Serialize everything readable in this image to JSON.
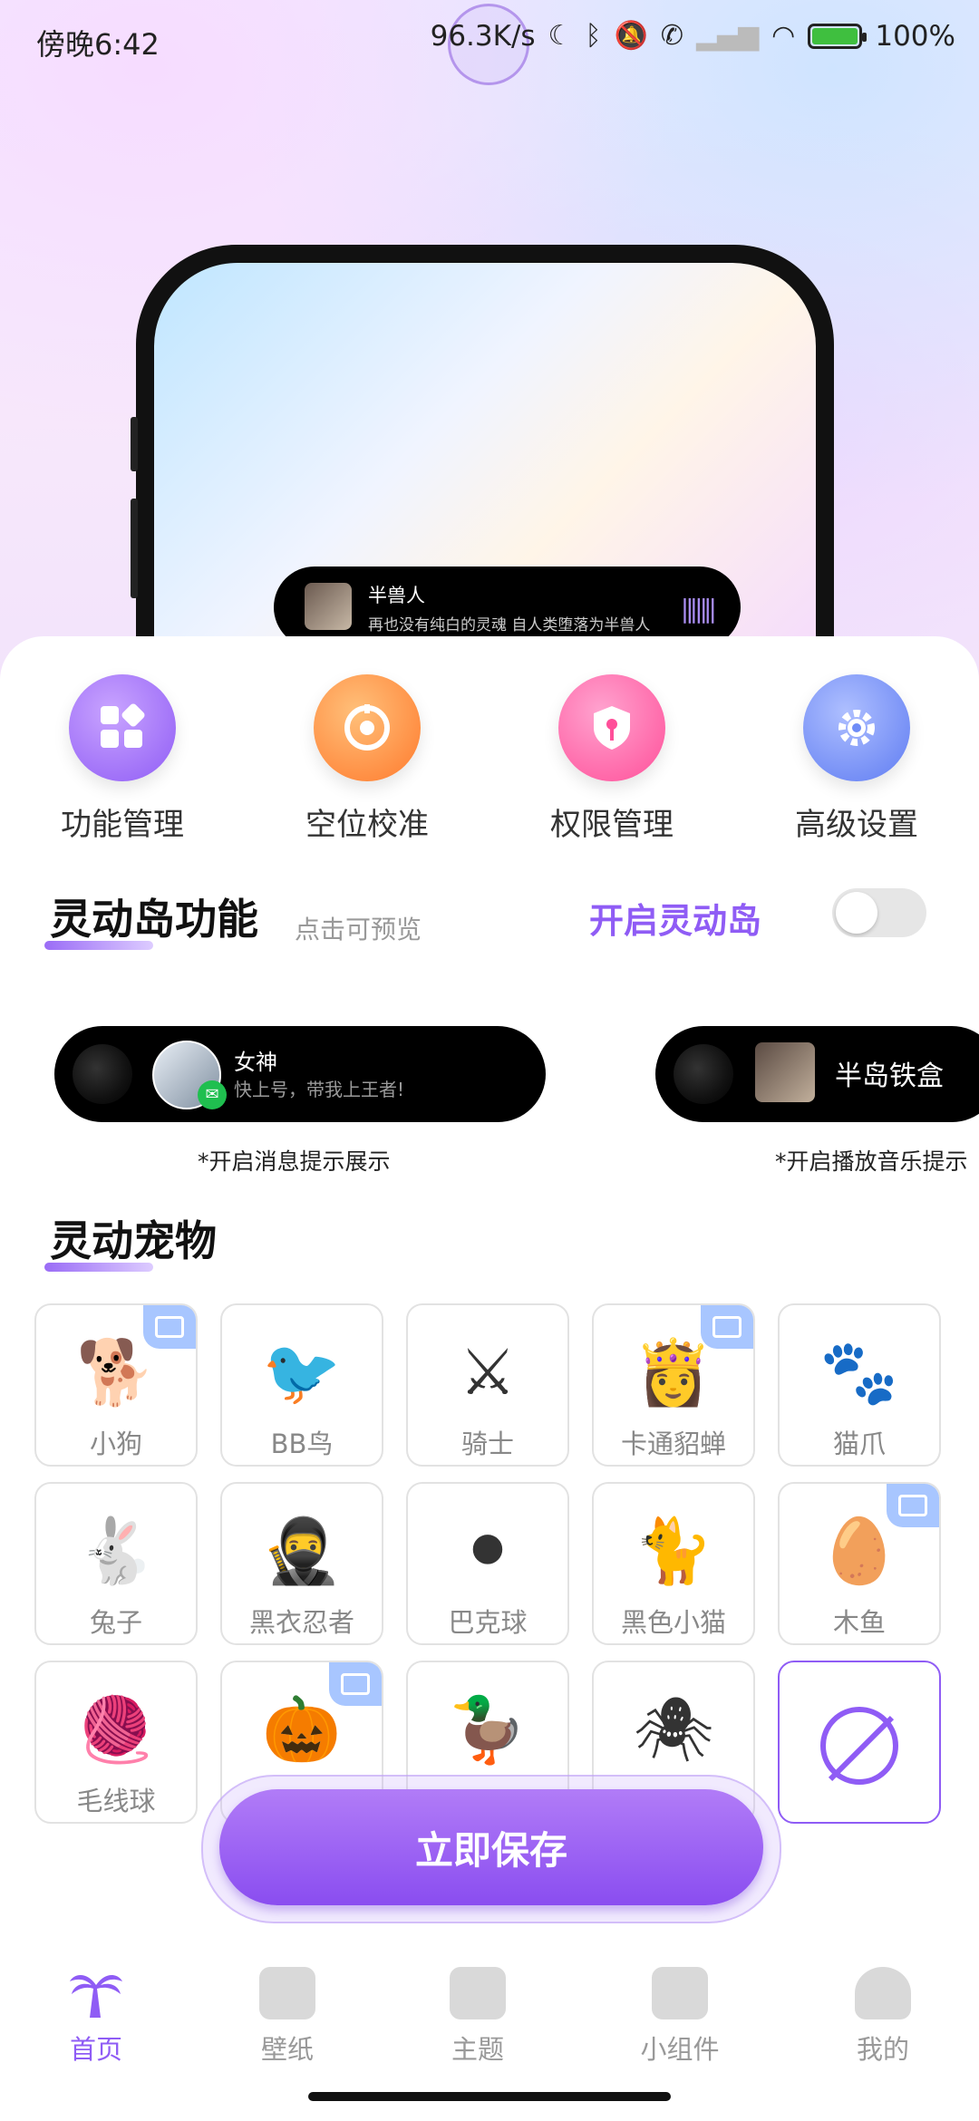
{
  "status_bar": {
    "time": "傍晚6:42",
    "network_speed": "96.3K/s",
    "battery": "100%"
  },
  "preview": {
    "island_title": "半兽人",
    "island_subtitle": "再也没有纯白的灵魂 自人类堕落为半兽人"
  },
  "quick_actions": [
    {
      "label": "功能管理",
      "icon": "grid-apps-icon",
      "color": "#9b6cf4"
    },
    {
      "label": "空位校准",
      "icon": "target-icon",
      "color": "#ff8a3d"
    },
    {
      "label": "权限管理",
      "icon": "key-shield-icon",
      "color": "#ff5fa8"
    },
    {
      "label": "高级设置",
      "icon": "gear-icon",
      "color": "#6f8cf7"
    }
  ],
  "island_section": {
    "title": "灵动岛功能",
    "hint": "点击可预览",
    "enable_label": "开启灵动岛",
    "enabled": false
  },
  "island_examples": [
    {
      "name": "女神",
      "message": "快上号，带我上王者!",
      "caption": "*开启消息提示展示"
    },
    {
      "name": "半岛铁盒",
      "caption": "*开启播放音乐提示"
    }
  ],
  "pets_section": {
    "title": "灵动宠物"
  },
  "pets": [
    {
      "name": "小狗",
      "icon": "dog-icon",
      "glyph": "🐕",
      "video": true
    },
    {
      "name": "BB鸟",
      "icon": "bird-icon",
      "glyph": "🐦",
      "video": false
    },
    {
      "name": "骑士",
      "icon": "knight-icon",
      "glyph": "⚔",
      "video": false
    },
    {
      "name": "卡通貂蝉",
      "icon": "cartoon-girl-icon",
      "glyph": "👸",
      "video": true
    },
    {
      "name": "猫爪",
      "icon": "cat-paw-icon",
      "glyph": "🐾",
      "video": false
    },
    {
      "name": "兔子",
      "icon": "rabbit-icon",
      "glyph": "🐇",
      "video": false
    },
    {
      "name": "黑衣忍者",
      "icon": "ninja-icon",
      "glyph": "🥷",
      "video": false
    },
    {
      "name": "巴克球",
      "icon": "black-ball-icon",
      "glyph": "⚫",
      "video": false
    },
    {
      "name": "黑色小猫",
      "icon": "black-cat-icon",
      "glyph": "🐈",
      "video": false
    },
    {
      "name": "木鱼",
      "icon": "wooden-fish-icon",
      "glyph": "🥚",
      "video": true
    },
    {
      "name": "毛线球",
      "icon": "yarn-ball-icon",
      "glyph": "🧶",
      "video": false
    },
    {
      "name": "",
      "icon": "pumpkin-icon",
      "glyph": "🎃",
      "video": true
    },
    {
      "name": "",
      "icon": "duck-icon",
      "glyph": "🦆",
      "video": false
    },
    {
      "name": "",
      "icon": "spider-mask-icon",
      "glyph": "🕷",
      "video": false
    },
    {
      "name": "",
      "icon": "none-icon",
      "glyph": "",
      "video": false,
      "selected": true
    }
  ],
  "save_button": "立即保存",
  "tabs": [
    {
      "label": "首页",
      "icon": "palm-tree-icon",
      "active": true
    },
    {
      "label": "壁纸",
      "icon": "wallpaper-icon",
      "active": false
    },
    {
      "label": "主题",
      "icon": "shirt-icon",
      "active": false
    },
    {
      "label": "小组件",
      "icon": "widgets-icon",
      "active": false
    },
    {
      "label": "我的",
      "icon": "person-icon",
      "active": false
    }
  ],
  "colors": {
    "accent": "#8f5cf5",
    "toggle_off": "#e6e6e6"
  }
}
